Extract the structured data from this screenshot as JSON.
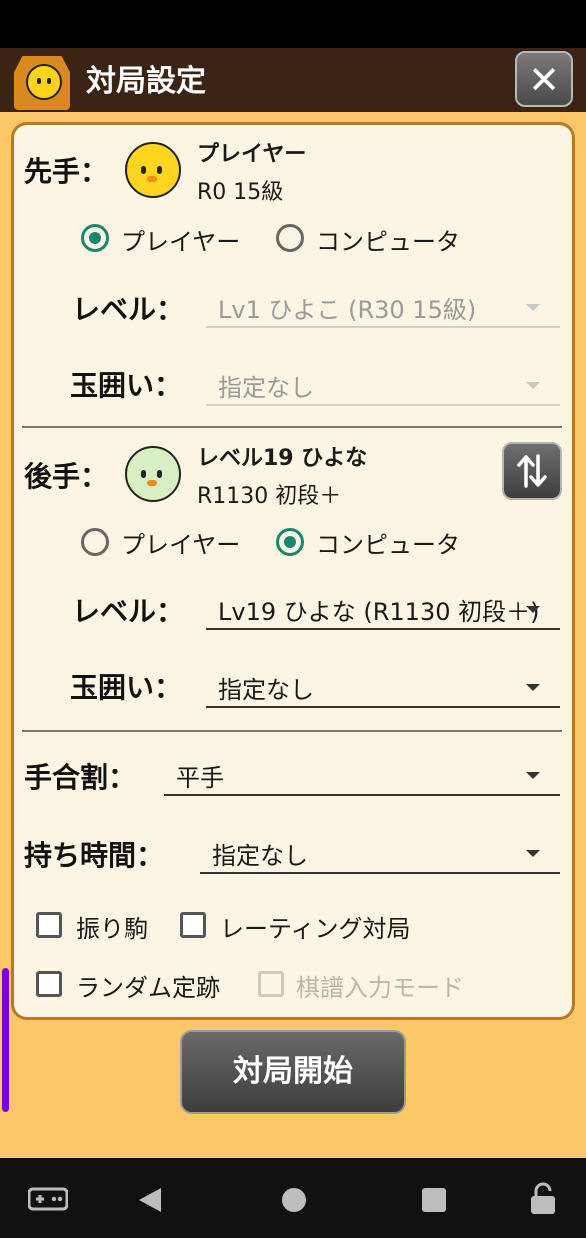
{
  "header": {
    "title": "対局設定"
  },
  "sente": {
    "label": "先手：",
    "name": "プレイヤー",
    "rank": "R0 15級",
    "radio_player": "プレイヤー",
    "radio_computer": "コンピュータ",
    "level_label": "レベル：",
    "level_value": "Lv1 ひよこ (R30 15級)",
    "castle_label": "玉囲い：",
    "castle_value": "指定なし"
  },
  "gote": {
    "label": "後手：",
    "name": "レベル19 ひよな",
    "rank": "R1130 初段＋",
    "radio_player": "プレイヤー",
    "radio_computer": "コンピュータ",
    "level_label": "レベル：",
    "level_value": "Lv19 ひよな (R1130 初段＋)",
    "castle_label": "玉囲い：",
    "castle_value": "指定なし"
  },
  "handicap": {
    "label": "手合割：",
    "value": "平手"
  },
  "time": {
    "label": "持ち時間：",
    "value": "指定なし"
  },
  "options": {
    "furigoma": "振り駒",
    "rating": "レーティング対局",
    "random_joseki": "ランダム定跡",
    "kifu_input": "棋譜入力モード"
  },
  "start_button": "対局開始",
  "colors": {
    "accent": "#18876e",
    "panel_border": "#b97825",
    "background": "#fcc766",
    "title_bar": "#3b2414"
  }
}
